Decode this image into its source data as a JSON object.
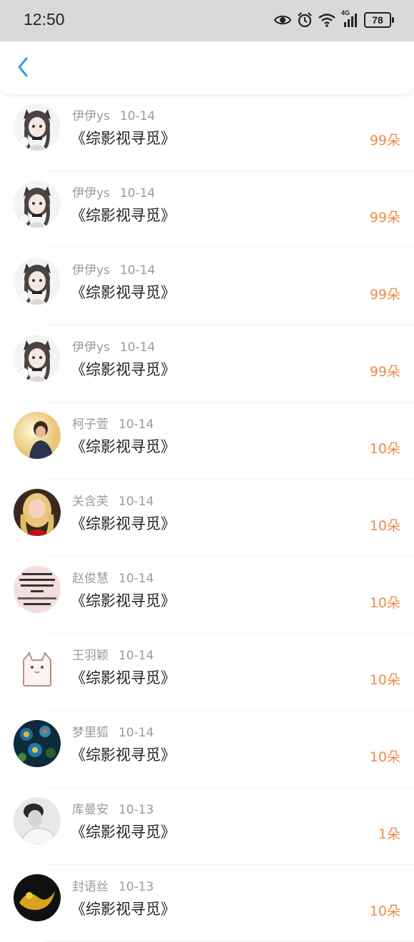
{
  "status_bar": {
    "time": "12:50",
    "network": "4G",
    "battery": "78",
    "icons": [
      "eye-icon",
      "alarm-icon",
      "wifi-icon",
      "signal-icon",
      "battery-icon"
    ]
  },
  "nav": {
    "back_icon": "chevron-left-icon",
    "accent_color": "#2f9be8"
  },
  "colors": {
    "amount": "#f08a4b",
    "name": "#9a9a9a",
    "title": "#222222"
  },
  "gifts": [
    {
      "name": "伊伊ys",
      "date": "10-14",
      "title": "《综影视寻觅》",
      "amount": "99朵",
      "avatar": "anime-girl-avatar"
    },
    {
      "name": "伊伊ys",
      "date": "10-14",
      "title": "《综影视寻觅》",
      "amount": "99朵",
      "avatar": "anime-girl-avatar"
    },
    {
      "name": "伊伊ys",
      "date": "10-14",
      "title": "《综影视寻觅》",
      "amount": "99朵",
      "avatar": "anime-girl-avatar"
    },
    {
      "name": "伊伊ys",
      "date": "10-14",
      "title": "《综影视寻觅》",
      "amount": "99朵",
      "avatar": "anime-girl-avatar"
    },
    {
      "name": "柯子萱",
      "date": "10-14",
      "title": "《综影视寻觅》",
      "amount": "10朵",
      "avatar": "woman-photo-avatar"
    },
    {
      "name": "关含芙",
      "date": "10-14",
      "title": "《综影视寻觅》",
      "amount": "10朵",
      "avatar": "blonde-girl-avatar"
    },
    {
      "name": "赵俊慧",
      "date": "10-14",
      "title": "《综影视寻觅》",
      "amount": "10朵",
      "avatar": "text-image-avatar"
    },
    {
      "name": "王羽颖",
      "date": "10-14",
      "title": "《综影视寻觅》",
      "amount": "10朵",
      "avatar": "cat-sketch-avatar"
    },
    {
      "name": "梦里狐",
      "date": "10-14",
      "title": "《综影视寻觅》",
      "amount": "10朵",
      "avatar": "peacock-feather-avatar"
    },
    {
      "name": "库曼安",
      "date": "10-13",
      "title": "《综影视寻觅》",
      "amount": "1朵",
      "avatar": "monochrome-photo-avatar"
    },
    {
      "name": "封语丝",
      "date": "10-13",
      "title": "《综影视寻觅》",
      "amount": "10朵",
      "avatar": "golden-dragon-avatar"
    }
  ]
}
